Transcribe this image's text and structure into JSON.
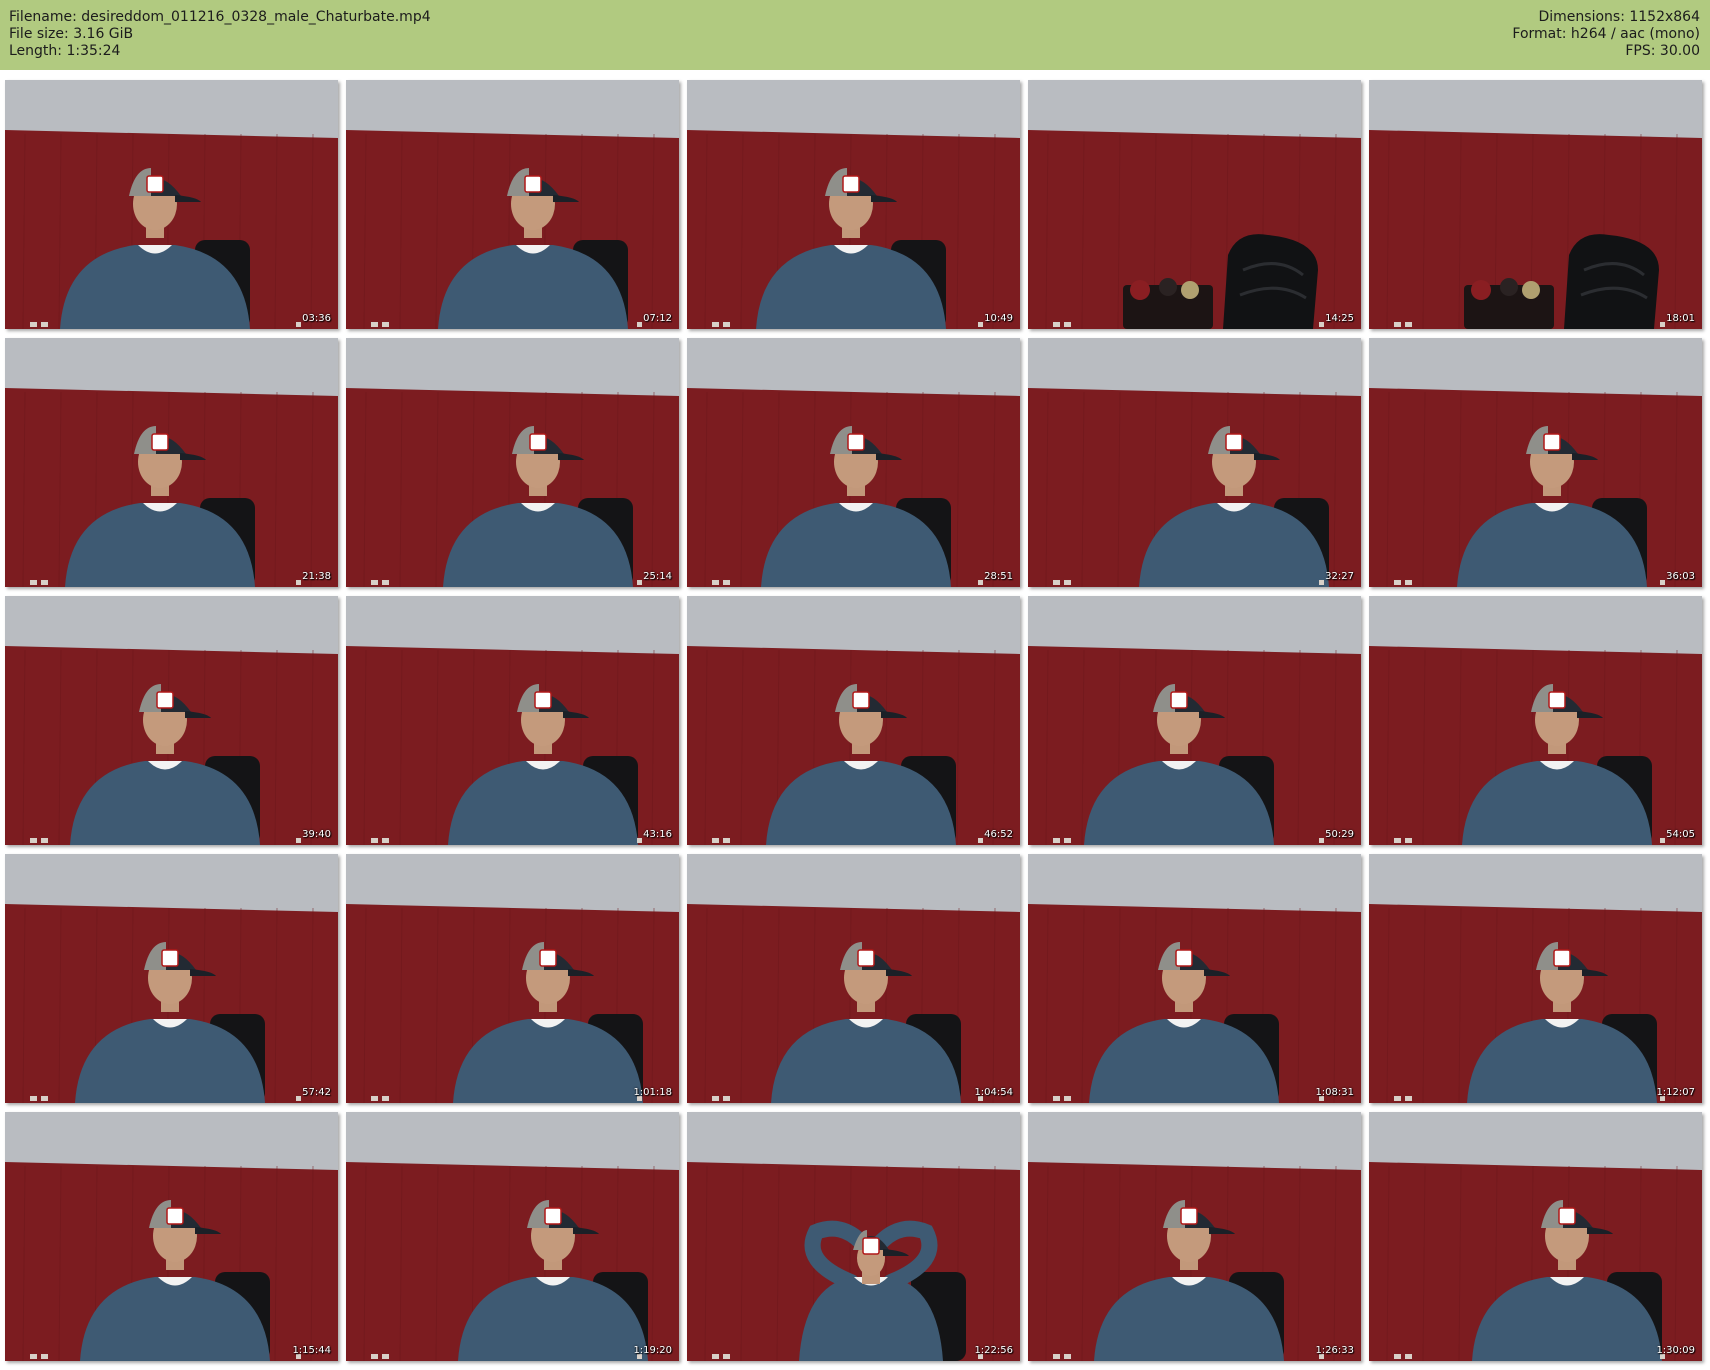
{
  "header": {
    "filename_line": "Filename: desireddom_011216_0328_male_Chaturbate.mp4",
    "filesize_line": "File size: 3.16 GiB",
    "length_line": "Length: 1:35:24",
    "dimensions_line": "Dimensions: 1152x864",
    "format_line": "Format: h264 / aac (mono)",
    "fps_line": "FPS: 30.00"
  },
  "colors": {
    "header_bg": "#b1ca80",
    "wall_red": "#7c1c20",
    "ceiling_gray": "#b9bcc1",
    "sweater_blue": "#3e5a73"
  },
  "thumbnails": [
    {
      "time": "03:36",
      "scene": "man"
    },
    {
      "time": "07:12",
      "scene": "man"
    },
    {
      "time": "10:49",
      "scene": "man"
    },
    {
      "time": "14:25",
      "scene": "empty-chair"
    },
    {
      "time": "18:01",
      "scene": "empty-chair"
    },
    {
      "time": "21:38",
      "scene": "man"
    },
    {
      "time": "25:14",
      "scene": "man"
    },
    {
      "time": "28:51",
      "scene": "man"
    },
    {
      "time": "32:27",
      "scene": "man"
    },
    {
      "time": "36:03",
      "scene": "man"
    },
    {
      "time": "39:40",
      "scene": "man"
    },
    {
      "time": "43:16",
      "scene": "man"
    },
    {
      "time": "46:52",
      "scene": "man"
    },
    {
      "time": "50:29",
      "scene": "man"
    },
    {
      "time": "54:05",
      "scene": "man"
    },
    {
      "time": "57:42",
      "scene": "man"
    },
    {
      "time": "1:01:18",
      "scene": "man"
    },
    {
      "time": "1:04:54",
      "scene": "man"
    },
    {
      "time": "1:08:31",
      "scene": "man"
    },
    {
      "time": "1:12:07",
      "scene": "man"
    },
    {
      "time": "1:15:44",
      "scene": "man"
    },
    {
      "time": "1:19:20",
      "scene": "man"
    },
    {
      "time": "1:22:56",
      "scene": "man-arms-up"
    },
    {
      "time": "1:26:33",
      "scene": "man"
    },
    {
      "time": "1:30:09",
      "scene": "man"
    }
  ]
}
